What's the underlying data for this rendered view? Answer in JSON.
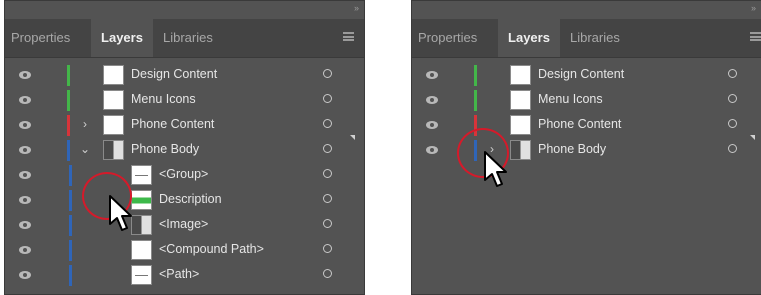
{
  "panel_left": {
    "tabs": [
      "Properties",
      "Layers",
      "Libraries"
    ],
    "active_tab": "Layers",
    "collapse_glyph": "››",
    "rows": [
      {
        "label": "Design Content",
        "color": "#43b649",
        "expander": "",
        "thumb": "plain",
        "indent": 0
      },
      {
        "label": "Menu Icons",
        "color": "#43b649",
        "expander": "",
        "thumb": "plain",
        "indent": 0
      },
      {
        "label": "Phone Content",
        "color": "#d7343a",
        "expander": "›",
        "thumb": "plain",
        "indent": 0
      },
      {
        "label": "Phone Body",
        "color": "#2f65b8",
        "expander": "⌄",
        "thumb": "img",
        "indent": 0
      },
      {
        "label": "<Group>",
        "color": "#2f65b8",
        "expander": "",
        "thumb": "small-line",
        "indent": 1
      },
      {
        "label": "Description",
        "color": "#2f65b8",
        "expander": "›",
        "thumb": "green",
        "indent": 1
      },
      {
        "label": "<Image>",
        "color": "#2f65b8",
        "expander": "",
        "thumb": "img",
        "indent": 1
      },
      {
        "label": "<Compound Path>",
        "color": "#2f65b8",
        "expander": "",
        "thumb": "plain",
        "indent": 1
      },
      {
        "label": "<Path>",
        "color": "#2f65b8",
        "expander": "",
        "thumb": "small-line",
        "indent": 1
      }
    ]
  },
  "panel_right": {
    "tabs": [
      "Properties",
      "Layers",
      "Libraries"
    ],
    "active_tab": "Layers",
    "collapse_glyph": "››",
    "rows": [
      {
        "label": "Design Content",
        "color": "#43b649",
        "expander": "",
        "thumb": "plain"
      },
      {
        "label": "Menu Icons",
        "color": "#43b649",
        "expander": "",
        "thumb": "plain"
      },
      {
        "label": "Phone Content",
        "color": "#d7343a",
        "expander": "",
        "thumb": "plain"
      },
      {
        "label": "Phone Body",
        "color": "#2f65b8",
        "expander": "›",
        "thumb": "img"
      }
    ]
  },
  "colors": {
    "panel_bg": "#535353",
    "tabbar_bg": "#444444",
    "annotation_red": "#d51a2a"
  },
  "icons": [
    "eye-icon",
    "target-circle-icon",
    "disclosure-arrow-icon",
    "panel-menu-icon",
    "mouse-pointer-icon"
  ]
}
